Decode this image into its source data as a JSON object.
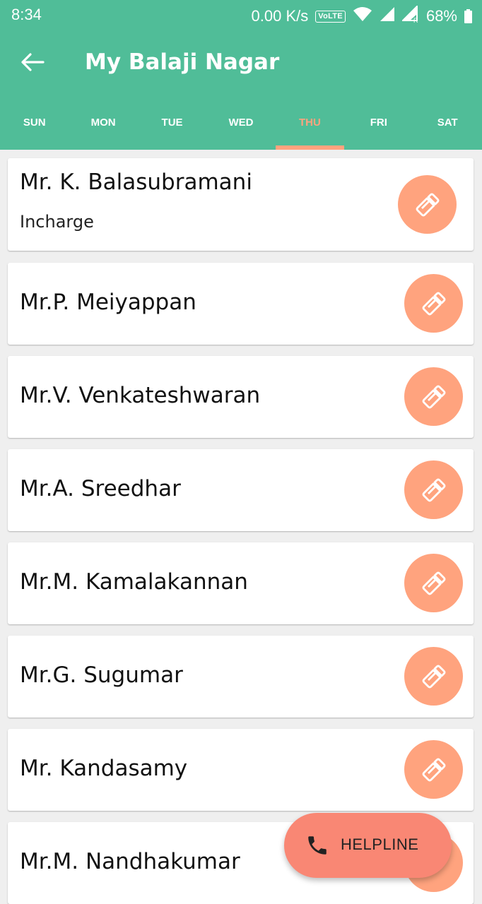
{
  "status_bar": {
    "time": "8:34",
    "network_speed": "0.00 K/s",
    "volte": "VoLTE",
    "battery": "68%",
    "icons": [
      "wifi-icon",
      "signal-icon",
      "signal-roaming-icon",
      "battery-icon"
    ]
  },
  "toolbar": {
    "back_icon": "arrow-back-icon",
    "title": "My Balaji Nagar"
  },
  "tabs": [
    {
      "label": "SUN",
      "active": false
    },
    {
      "label": "MON",
      "active": false
    },
    {
      "label": "TUE",
      "active": false
    },
    {
      "label": "WED",
      "active": false
    },
    {
      "label": "THU",
      "active": true
    },
    {
      "label": "FRI",
      "active": false
    },
    {
      "label": "SAT",
      "active": false
    }
  ],
  "contacts": [
    {
      "name": "Mr. K. Balasubramani",
      "role": "Incharge"
    },
    {
      "name": "Mr.P. Meiyappan"
    },
    {
      "name": "Mr.V. Venkateshwaran"
    },
    {
      "name": "Mr.A. Sreedhar"
    },
    {
      "name": "Mr.M. Kamalakannan"
    },
    {
      "name": "Mr.G. Sugumar"
    },
    {
      "name": "Mr. Kandasamy"
    },
    {
      "name": "Mr.M. Nandhakumar"
    }
  ],
  "helpline": {
    "label": "HELPLINE",
    "icon": "phone-icon"
  },
  "colors": {
    "primary": "#50bd98",
    "accent": "#ffa37e",
    "fab": "#f98774",
    "background": "#efefef"
  }
}
